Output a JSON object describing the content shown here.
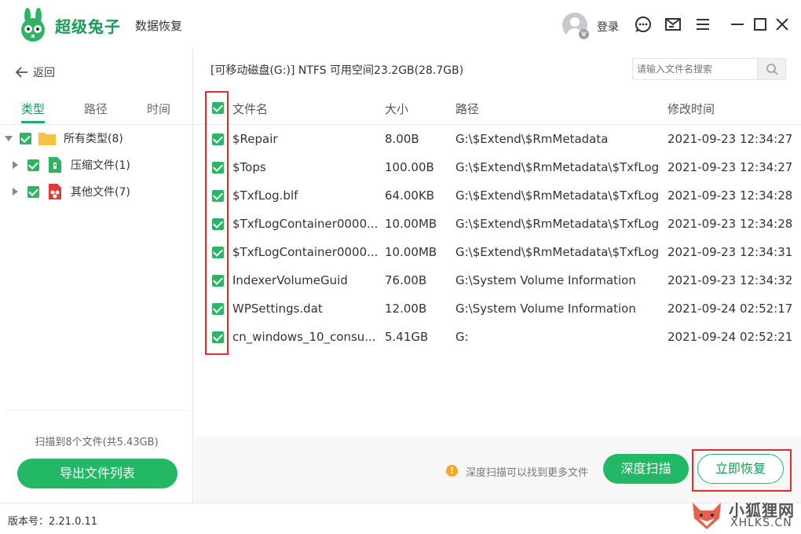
{
  "app": {
    "brand": "超级兔子",
    "brand_sub": "数据恢复",
    "login": "登录",
    "avatar_badge": "V"
  },
  "sidebar": {
    "back": "返回",
    "tabs": [
      "类型",
      "路径",
      "时间"
    ],
    "tree": [
      {
        "label": "所有类型(8)"
      },
      {
        "label": "压缩文件(1)"
      },
      {
        "label": "其他文件(7)"
      }
    ],
    "scan_info": "扫描到8个文件(共5.43GB)",
    "export_label": "导出文件列表"
  },
  "main": {
    "drive_info": "[可移动磁盘(G:)] NTFS 可用空间23.2GB(28.7GB)",
    "search_placeholder": "请输入文件名搜索",
    "headers": {
      "name": "文件名",
      "size": "大小",
      "path": "路径",
      "time": "修改时间"
    },
    "rows": [
      {
        "name": "$Repair",
        "size": "8.00B",
        "path": "G:\\$Extend\\$RmMetadata",
        "time": "2021-09-23 12:34:27"
      },
      {
        "name": "$Tops",
        "size": "100.00B",
        "path": "G:\\$Extend\\$RmMetadata\\$TxfLog",
        "time": "2021-09-23 12:34:27"
      },
      {
        "name": "$TxfLog.blf",
        "size": "64.00KB",
        "path": "G:\\$Extend\\$RmMetadata\\$TxfLog",
        "time": "2021-09-23 12:34:28"
      },
      {
        "name": "$TxfLogContainer0000...",
        "size": "10.00MB",
        "path": "G:\\$Extend\\$RmMetadata\\$TxfLog",
        "time": "2021-09-23 12:34:28"
      },
      {
        "name": "$TxfLogContainer0000...",
        "size": "10.00MB",
        "path": "G:\\$Extend\\$RmMetadata\\$TxfLog",
        "time": "2021-09-23 12:34:31"
      },
      {
        "name": "IndexerVolumeGuid",
        "size": "76.00B",
        "path": "G:\\System Volume Information",
        "time": "2021-09-23 12:34:32"
      },
      {
        "name": "WPSettings.dat",
        "size": "12.00B",
        "path": "G:\\System Volume Information",
        "time": "2021-09-24 02:52:17"
      },
      {
        "name": "cn_windows_10_consu...",
        "size": "5.41GB",
        "path": "G:",
        "time": "2021-09-24 02:52:21"
      }
    ],
    "hint": "深度扫描可以找到更多文件",
    "hint_icon": "!",
    "deep_scan_label": "深度扫描",
    "recover_label": "立即恢复"
  },
  "footer": {
    "version": "版本号：2.21.0.11"
  },
  "watermark": {
    "cn": "小狐狸网",
    "en": "XHLKS.CN"
  },
  "colors": {
    "accent": "#23b865",
    "highlight_box": "#e52a2a"
  }
}
